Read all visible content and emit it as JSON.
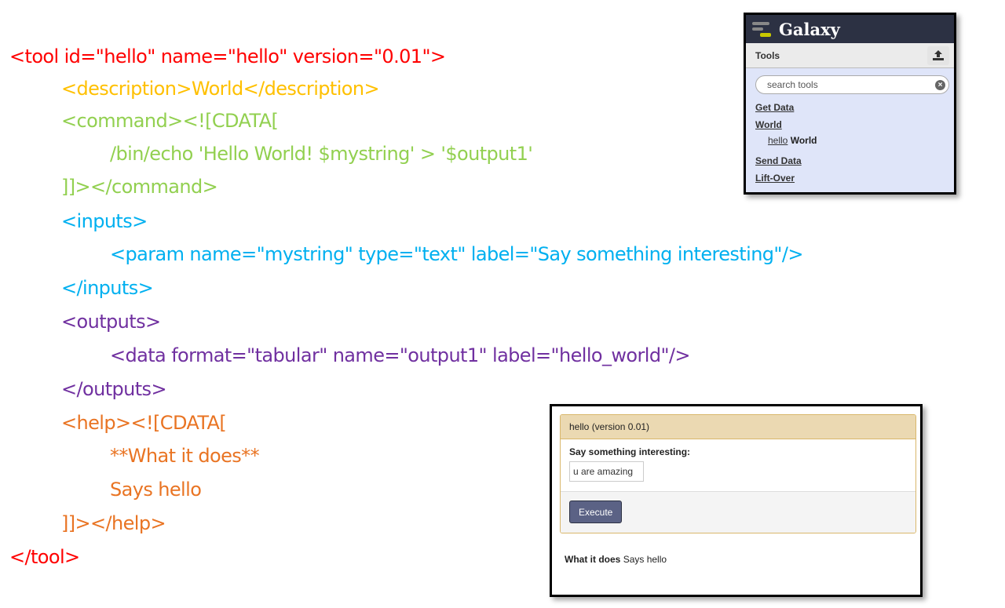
{
  "code": {
    "lines": [
      {
        "text": "<tool id=\"hello\" name=\"hello\" version=\"0.01\">",
        "color": "#ff0000"
      },
      {
        "text": "<description>World</description>",
        "color": "#ffc000"
      },
      {
        "text": "<command><![CDATA[",
        "color": "#92d050"
      },
      {
        "text": "/bin/echo 'Hello World! $mystring' > '$output1'",
        "color": "#92d050"
      },
      {
        "text": "]]></command>",
        "color": "#92d050"
      },
      {
        "text": "<inputs>",
        "color": "#00b0f0"
      },
      {
        "text": "<param name=\"mystring\" type=\"text\" label=\"Say something interesting\"/>",
        "color": "#00b0f0"
      },
      {
        "text": "</inputs>",
        "color": "#00b0f0"
      },
      {
        "text": "<outputs>",
        "color": "#7030a0"
      },
      {
        "text": "<data format=\"tabular\" name=\"output1\" label=\"hello_world\"/>",
        "color": "#7030a0"
      },
      {
        "text": "</outputs>",
        "color": "#7030a0"
      },
      {
        "text": "<help><![CDATA[",
        "color": "#e97423"
      },
      {
        "text": "**What it does**",
        "color": "#e97423"
      },
      {
        "text": "Says hello",
        "color": "#e97423"
      },
      {
        "text": "]]></help>",
        "color": "#e97423"
      },
      {
        "text": "</tool>",
        "color": "#ff0000"
      }
    ]
  },
  "galaxy": {
    "brand": "Galaxy",
    "tools_header": "Tools",
    "upload_icon": "upload-icon",
    "search_placeholder": "search tools",
    "sections": {
      "get_data": "Get Data",
      "world": "World",
      "send_data": "Send Data",
      "lift_over": "Lift-Over"
    },
    "tool": {
      "name": "hello",
      "description": "World"
    },
    "colors": {
      "masthead": "#2c3143",
      "panel_bg": "#dfe5f9"
    }
  },
  "tool_form": {
    "title": "hello (version 0.01)",
    "param_label": "Say something interesting:",
    "param_value": "u are amazing",
    "execute_label": "Execute",
    "help_bold": "What it does",
    "help_text": "Says hello",
    "colors": {
      "header_bg": "#ebd9b2",
      "button_bg": "#5b6285"
    }
  }
}
